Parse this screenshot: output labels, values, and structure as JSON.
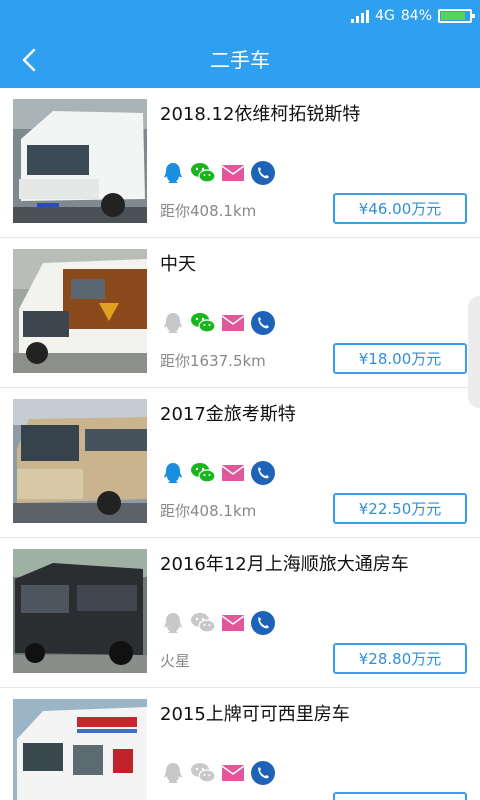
{
  "status_bar": {
    "network": "4G",
    "battery": "84%",
    "battery_level": 0.84
  },
  "header": {
    "title": "二手车",
    "back_icon": "chevron-left-icon"
  },
  "listings": [
    {
      "title": "2018.12依维柯拓锐斯特",
      "distance": "距你408.1km",
      "price": "¥46.00万元",
      "contacts": {
        "qq": true,
        "wechat": true,
        "email": true,
        "phone": true
      }
    },
    {
      "title": "中天",
      "distance": "距你1637.5km",
      "price": "¥18.00万元",
      "contacts": {
        "qq": false,
        "wechat": true,
        "email": true,
        "phone": true
      }
    },
    {
      "title": "2017金旅考斯特",
      "distance": "距你408.1km",
      "price": "¥22.50万元",
      "contacts": {
        "qq": true,
        "wechat": true,
        "email": true,
        "phone": true
      }
    },
    {
      "title": "2016年12月上海顺旅大通房车",
      "distance": "火星",
      "price": "¥28.80万元",
      "contacts": {
        "qq": false,
        "wechat": false,
        "email": true,
        "phone": true
      }
    },
    {
      "title": "2015上牌可可西里房车",
      "distance": "",
      "price": "",
      "contacts": {
        "qq": false,
        "wechat": false,
        "email": true,
        "phone": true
      }
    }
  ],
  "colors": {
    "primary": "#2f9ff0",
    "qq": "#1a8fe0",
    "wechat": "#19b51d",
    "email": "#e0579b",
    "phone": "#1f63b8",
    "disabled": "#c8c8c8"
  }
}
